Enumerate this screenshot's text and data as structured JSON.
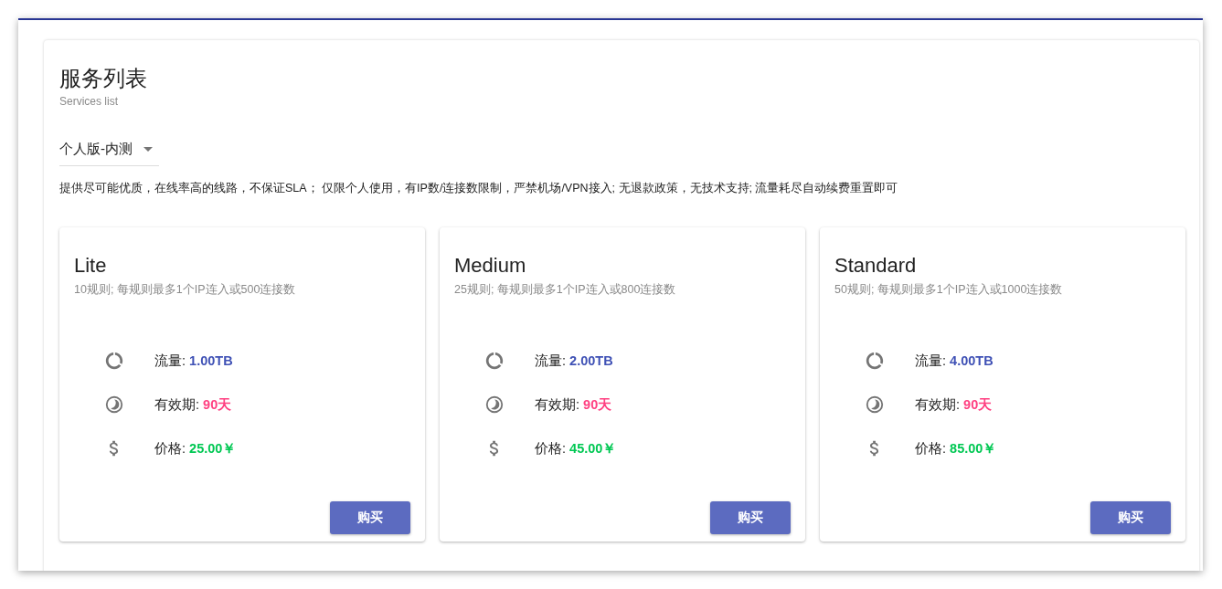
{
  "page": {
    "title": "服务列表",
    "subtitle": "Services list"
  },
  "plan_select": {
    "value": "个人版-内测"
  },
  "description": "提供尽可能优质，在线率高的线路，不保证SLA； 仅限个人使用，有IP数/连接数限制，严禁机场/VPN接入; 无退款政策，无技术支持; 流量耗尽自动续费重置即可",
  "services": [
    {
      "name": "Lite",
      "details": "10规则; 每规则最多1个IP连入或500连接数",
      "specs": [
        {
          "kind": "traffic",
          "label": "流量:",
          "value": "1.00TB"
        },
        {
          "kind": "validity",
          "label": "有效期:",
          "value": "90天"
        },
        {
          "kind": "price",
          "label": "价格:",
          "value": "25.00￥"
        }
      ],
      "button": "购买"
    },
    {
      "name": "Medium",
      "details": "25规则; 每规则最多1个IP连入或800连接数",
      "specs": [
        {
          "kind": "traffic",
          "label": "流量:",
          "value": "2.00TB"
        },
        {
          "kind": "validity",
          "label": "有效期:",
          "value": "90天"
        },
        {
          "kind": "price",
          "label": "价格:",
          "value": "45.00￥"
        }
      ],
      "button": "购买"
    },
    {
      "name": "Standard",
      "details": "50规则; 每规则最多1个IP连入或1000连接数",
      "specs": [
        {
          "kind": "traffic",
          "label": "流量:",
          "value": "4.00TB"
        },
        {
          "kind": "validity",
          "label": "有效期:",
          "value": "90天"
        },
        {
          "kind": "price",
          "label": "价格:",
          "value": "85.00￥"
        }
      ],
      "button": "购买"
    }
  ]
}
